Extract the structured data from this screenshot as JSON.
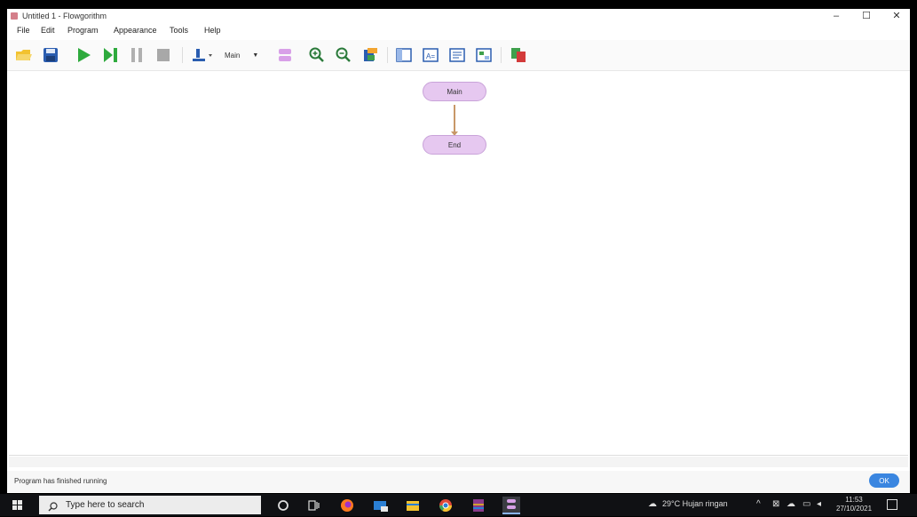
{
  "window": {
    "title": "Untitled 1 - Flowgorithm",
    "controls": {
      "minimize": "–",
      "maximize": "☐",
      "close": "✕"
    }
  },
  "menu": [
    "File",
    "Edit",
    "Program",
    "Appearance",
    "Tools",
    "Help"
  ],
  "toolbar": {
    "buttons": [
      "open-icon",
      "save-icon",
      "run-icon",
      "step-icon",
      "pause-icon",
      "stop-icon",
      "add-icon",
      "zoom-in-icon",
      "zoom-out-icon",
      "layout-icon",
      "panel-icon",
      "variables-icon",
      "console-icon",
      "chart-icon",
      "code-icon"
    ],
    "function_select": "Main",
    "colors": {
      "green": "#2eaa3d",
      "blue": "#2a5db0",
      "gray": "#9a9a9a",
      "purple": "#d8a0e8"
    }
  },
  "flowchart": {
    "nodes": [
      {
        "label": "Main",
        "type": "start"
      },
      {
        "label": "End",
        "type": "end"
      }
    ],
    "node_color": "#e6c8f0",
    "arrow_color": "#c89868"
  },
  "status": {
    "text": "Program has finished running",
    "button": "OK"
  },
  "taskbar": {
    "search_placeholder": "Type here to search",
    "weather": "29°C Hujan ringan",
    "time": "11:53",
    "date": "27/10/2021"
  }
}
